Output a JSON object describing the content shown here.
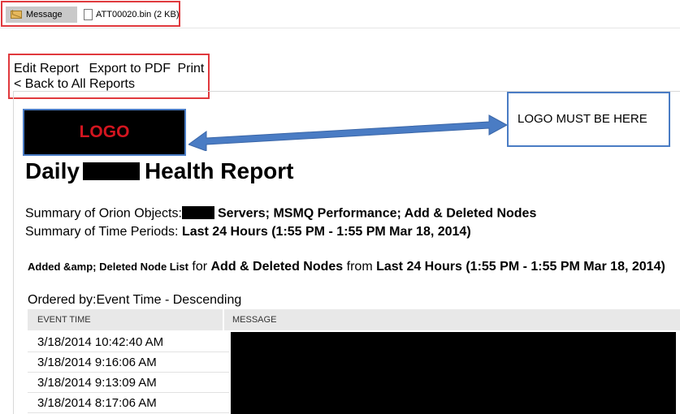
{
  "attachments": {
    "message_label": "Message",
    "file_label": "ATT00020.bin (2 KB)"
  },
  "actions": {
    "edit_report": "Edit Report",
    "export_pdf": "Export to PDF",
    "print": "Print",
    "back": "< Back to All Reports"
  },
  "logo": {
    "text": "LOGO",
    "callout": "LOGO MUST BE HERE"
  },
  "report": {
    "title_prefix": "Daily",
    "title_suffix": "Health Report",
    "summary_objects_label": "Summary of Orion Objects:",
    "summary_objects_value": "Servers; MSMQ Performance; Add & Deleted Nodes",
    "summary_time_label": "Summary of Time Periods:",
    "summary_time_value": "Last 24 Hours (1:55 PM - 1:55 PM Mar 18, 2014)",
    "section_name": "Added &amp; Deleted Node List",
    "section_for": "for",
    "section_object": "Add & Deleted Nodes",
    "section_from": "from",
    "section_period": "Last 24 Hours (1:55 PM - 1:55 PM Mar 18, 2014)",
    "ordered_by": "Ordered by:Event Time - Descending"
  },
  "table": {
    "headers": [
      "EVENT TIME",
      "MESSAGE"
    ],
    "rows": [
      "3/18/2014 10:42:40 AM",
      "3/18/2014 9:16:06 AM",
      "3/18/2014 9:13:09 AM",
      "3/18/2014 8:17:06 AM"
    ]
  },
  "colors": {
    "red_highlight": "#e0393d",
    "blue_highlight": "#4a7cc4",
    "logo_text": "#d3151f"
  }
}
